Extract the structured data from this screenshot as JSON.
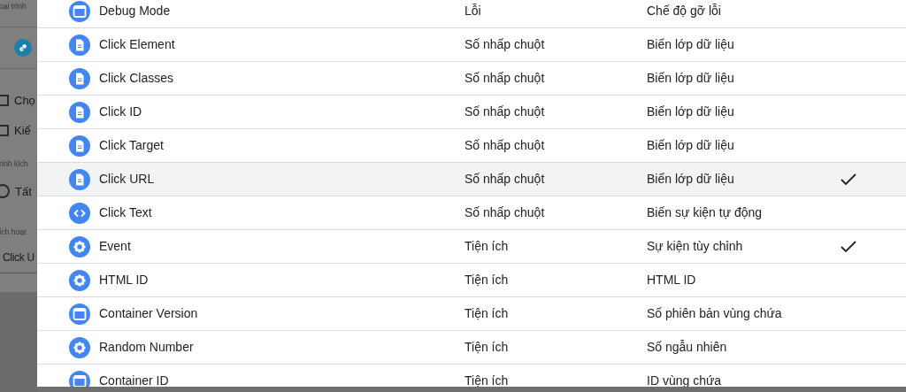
{
  "background_panel": {
    "header": "oại trình",
    "checkboxes": [
      {
        "label": "Chọ",
        "checked": false
      },
      {
        "label": "Kiể",
        "checked": false
      }
    ],
    "section_label": "rình kích",
    "radio": {
      "label": "Tất",
      "selected": false
    },
    "trigger_label": "ích hoạt",
    "field_value": "Click U"
  },
  "variables": [
    {
      "kind": "window",
      "name": "Debug Mode",
      "type": "Lỗi",
      "category": "Chế độ gỡ lỗi",
      "checked": false,
      "highlighted": false
    },
    {
      "kind": "doc",
      "name": "Click Element",
      "type": "Số nhấp chuột",
      "category": "Biến lớp dữ liệu",
      "checked": false,
      "highlighted": false
    },
    {
      "kind": "doc",
      "name": "Click Classes",
      "type": "Số nhấp chuột",
      "category": "Biến lớp dữ liệu",
      "checked": false,
      "highlighted": false
    },
    {
      "kind": "doc",
      "name": "Click ID",
      "type": "Số nhấp chuột",
      "category": "Biến lớp dữ liệu",
      "checked": false,
      "highlighted": false
    },
    {
      "kind": "doc",
      "name": "Click Target",
      "type": "Số nhấp chuột",
      "category": "Biến lớp dữ liệu",
      "checked": false,
      "highlighted": false
    },
    {
      "kind": "doc",
      "name": "Click URL",
      "type": "Số nhấp chuột",
      "category": "Biến lớp dữ liệu",
      "checked": true,
      "highlighted": true
    },
    {
      "kind": "code",
      "name": "Click Text",
      "type": "Số nhấp chuột",
      "category": "Biến sự kiện tự động",
      "checked": false,
      "highlighted": false
    },
    {
      "kind": "gear",
      "name": "Event",
      "type": "Tiện ích",
      "category": "Sự kiện tùy chỉnh",
      "checked": true,
      "highlighted": false
    },
    {
      "kind": "gear",
      "name": "HTML ID",
      "type": "Tiện ích",
      "category": "HTML ID",
      "checked": false,
      "highlighted": false
    },
    {
      "kind": "window",
      "name": "Container Version",
      "type": "Tiện ích",
      "category": "Số phiên bản vùng chứa",
      "checked": false,
      "highlighted": false
    },
    {
      "kind": "gear",
      "name": "Random Number",
      "type": "Tiện ích",
      "category": "Số ngẫu nhiên",
      "checked": false,
      "highlighted": false
    },
    {
      "kind": "window",
      "name": "Container ID",
      "type": "Tiện ích",
      "category": "ID vùng chứa",
      "checked": false,
      "highlighted": false
    }
  ]
}
